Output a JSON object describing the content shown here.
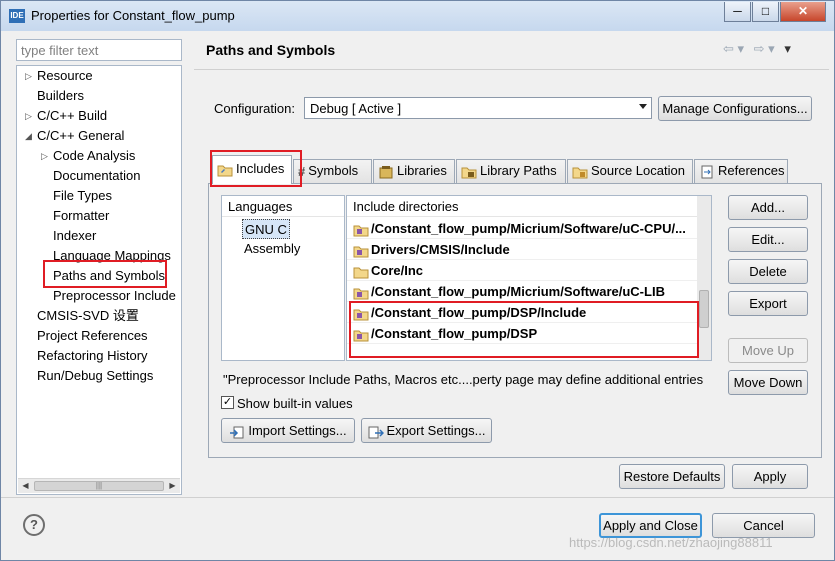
{
  "window": {
    "title": "Properties for Constant_flow_pump",
    "app_icon_label": "IDE",
    "minimize_glyph": "─",
    "maximize_glyph": "□",
    "close_glyph": "✕"
  },
  "sidebar": {
    "filter_placeholder": "type filter text",
    "items": [
      {
        "label": "Resource",
        "twisty": "▷"
      },
      {
        "label": "Builders",
        "twisty": ""
      },
      {
        "label": "C/C++ Build",
        "twisty": "▷"
      },
      {
        "label": "C/C++ General",
        "twisty": "◢"
      },
      {
        "label": "Code Analysis",
        "twisty": "▷"
      },
      {
        "label": "Documentation",
        "twisty": ""
      },
      {
        "label": "File Types",
        "twisty": ""
      },
      {
        "label": "Formatter",
        "twisty": ""
      },
      {
        "label": "Indexer",
        "twisty": ""
      },
      {
        "label": "Language Mappings",
        "twisty": ""
      },
      {
        "label": "Paths and Symbols",
        "twisty": ""
      },
      {
        "label": "Preprocessor Include",
        "twisty": ""
      },
      {
        "label": "CMSIS-SVD 设置",
        "twisty": ""
      },
      {
        "label": "Project References",
        "twisty": ""
      },
      {
        "label": "Refactoring History",
        "twisty": ""
      },
      {
        "label": "Run/Debug Settings",
        "twisty": ""
      }
    ],
    "scroll_left": "◀",
    "scroll_right": "▶",
    "scroll_grip": "|||"
  },
  "page": {
    "title": "Paths and Symbols",
    "nav_back": "⇦ ▾",
    "nav_forward": "⇨ ▾",
    "menu": "▾"
  },
  "configuration": {
    "label": "Configuration:",
    "value": "Debug  [ Active ]",
    "manage_button": "Manage Configurations..."
  },
  "tabs": [
    {
      "label": "Includes",
      "icon": "folder-includes-icon"
    },
    {
      "label": "Symbols",
      "icon": "hash-icon"
    },
    {
      "label": "Libraries",
      "icon": "library-icon"
    },
    {
      "label": "Library Paths",
      "icon": "library-path-icon"
    },
    {
      "label": "Source Location",
      "icon": "source-folder-icon"
    },
    {
      "label": "References",
      "icon": "references-icon"
    }
  ],
  "languages": {
    "header": "Languages",
    "items": [
      "GNU C",
      "Assembly"
    ],
    "selected": "GNU C"
  },
  "include_dirs": {
    "header": "Include directories",
    "rows": [
      {
        "path": "/Constant_flow_pump/Micrium/Software/uC-CPU/...",
        "icon": "workspace-folder-icon"
      },
      {
        "path": "Drivers/CMSIS/Include",
        "icon": "workspace-folder-icon"
      },
      {
        "path": "Core/Inc",
        "icon": "folder-icon"
      },
      {
        "path": "/Constant_flow_pump/Micrium/Software/uC-LIB",
        "icon": "workspace-folder-icon"
      },
      {
        "path": "/Constant_flow_pump/DSP/Include",
        "icon": "workspace-folder-icon"
      },
      {
        "path": "/Constant_flow_pump/DSP",
        "icon": "workspace-folder-icon"
      }
    ]
  },
  "side_buttons": {
    "add": "Add...",
    "edit": "Edit...",
    "delete": "Delete",
    "export": "Export",
    "move_up": "Move Up",
    "move_down": "Move Down"
  },
  "note": "\"Preprocessor Include Paths, Macros etc....perty page may define additional entries",
  "show_builtin": {
    "label": "Show built-in values",
    "checked": true
  },
  "import_button": "Import Settings...",
  "export_button": "Export Settings...",
  "restore_defaults_button": "Restore Defaults",
  "apply_button": "Apply",
  "apply_close_button": "Apply and Close",
  "cancel_button": "Cancel",
  "watermark": "https://blog.csdn.net/zhaojing88811",
  "colors": {
    "highlight_red": "#e01c24",
    "primary_border": "#3d95d8"
  }
}
